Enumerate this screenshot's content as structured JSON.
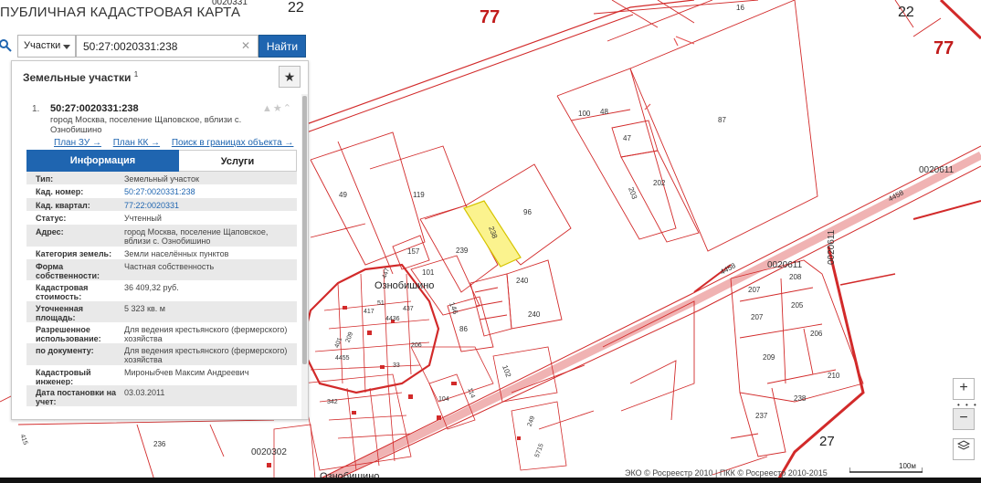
{
  "app": {
    "title": "ПУБЛИЧНАЯ КАДАСТРОВАЯ КАРТА"
  },
  "search": {
    "type_label": "Участки",
    "query": "50:27:0020331:238",
    "find_label": "Найти",
    "clear_icon": "close-icon"
  },
  "panel": {
    "title": "Земельные участки",
    "count_sup": "1",
    "star_icon": "★",
    "result": {
      "index": "1.",
      "number": "50:27:0020331:238",
      "address": "город Москва, поселение Щаповское, вблизи с. Ознобишино",
      "links": [
        "План ЗУ →",
        "План КК →",
        "Поиск в границах объекта →"
      ]
    },
    "tabs": [
      "Информация",
      "Услуги"
    ],
    "rows": [
      {
        "label": "Тип:",
        "value": "Земельный участок"
      },
      {
        "label": "Кад. номер:",
        "value": "50:27:0020331:238"
      },
      {
        "label": "Кад. квартал:",
        "value": "77:22:0020331"
      },
      {
        "label": "Статус:",
        "value": "Учтенный"
      },
      {
        "label": "Адрес:",
        "value": "город Москва, поселение Щаповское, вблизи с. Ознобишино"
      },
      {
        "label": "Категория земель:",
        "value": "Земли населённых пунктов"
      },
      {
        "label": "Форма собственности:",
        "value": "Частная собственность"
      },
      {
        "label": "Кадастровая стоимость:",
        "value": "36 409,32 руб."
      },
      {
        "label": "Уточненная площадь:",
        "value": "5 323 кв. м"
      },
      {
        "label": "Разрешенное использование:",
        "value": "Для ведения крестьянского (фермерского) хозяйства"
      },
      {
        "label": "по документу:",
        "value": "Для ведения крестьянского (фермерского) хозяйства"
      },
      {
        "label": "Кадастровый инженер:",
        "value": "Мироныбчев Максим Андреевич"
      },
      {
        "label": "Дата постановки на учет:",
        "value": "03.03.2011"
      }
    ]
  },
  "map": {
    "district_labels": [
      "77",
      "22",
      "22",
      "77",
      "27"
    ],
    "quarter_labels": [
      "0020331",
      "0020611",
      "0020611",
      "0020611",
      "0020302"
    ],
    "village_label": "Ознобишино",
    "village_label_bottom": "Ознобишино",
    "road_labels": [
      "4458",
      "4458"
    ],
    "parcel_labels": [
      "16",
      "100",
      "48",
      "47",
      "87",
      "203",
      "202",
      "49",
      "119",
      "96",
      "238",
      "239",
      "157",
      "101",
      "240",
      "240",
      "146",
      "86",
      "208",
      "207",
      "205",
      "207",
      "206",
      "209",
      "210",
      "238",
      "237",
      "102",
      "236"
    ],
    "village_parcel_labels": [
      "447",
      "51",
      "417",
      "4436",
      "437",
      "206",
      "33",
      "209",
      "401",
      "4455",
      "342",
      "104",
      "114",
      "415",
      "249",
      "5715"
    ],
    "selected_parcel": "238",
    "colors": {
      "boundary": "#d22a2a",
      "boundary_thin": "#e55555",
      "selected_fill": "#fbf38e",
      "road": "#f0b3b3",
      "accent": "#1f65b0"
    }
  },
  "controls": {
    "zoom_in": "+",
    "zoom_out": "−",
    "zoom_dots": "• • •",
    "layers_icon": "layers-icon"
  },
  "footer": {
    "attribution": "ЭКО © Росреестр 2010 | ПКК © Росреестр 2010-2015",
    "scale_label": "100м"
  }
}
